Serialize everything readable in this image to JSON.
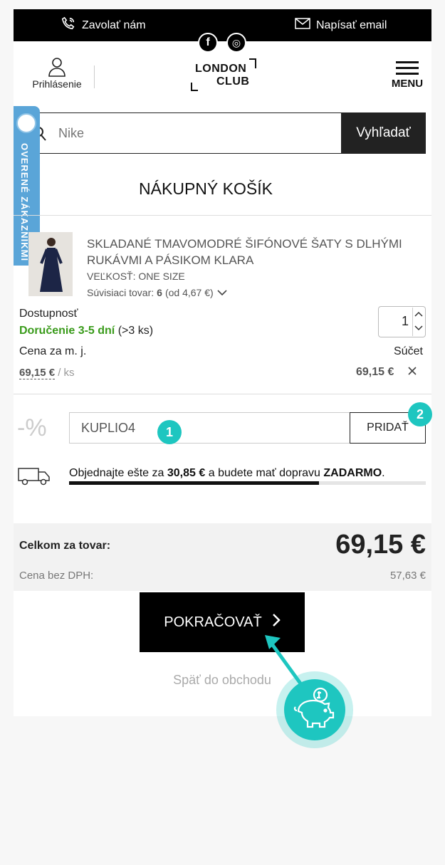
{
  "topbar": {
    "call_label": "Zavolať nám",
    "email_label": "Napísať email"
  },
  "social": {
    "facebook": "f",
    "instagram": "◎"
  },
  "header": {
    "login_label": "Prihlásenie",
    "logo_line1": "LONDON",
    "logo_line2": "CLUB",
    "menu_label": "MENU"
  },
  "search": {
    "placeholder": "Nike",
    "button_label": "Vyhľadať"
  },
  "side_tab": {
    "label": "OVERENÉ ZÁKAZNÍKMI"
  },
  "page_title": "NÁKUPNÝ KOŠÍK",
  "cart": {
    "item": {
      "name": "SKLADANÉ TMAVOMODRÉ ŠIFÓNOVÉ ŠATY S DLHÝMI RUKÁVMI A PÁSIKOM KLARA",
      "size": "VEĽKOSŤ: ONE SIZE",
      "related_prefix": "Súvisiaci tovar:",
      "related_count": "6",
      "related_from": "(od 4,67 €)",
      "availability_label": "Dostupnosť",
      "delivery": "Doručenie 3-5 dní",
      "stock": "(>3 ks)",
      "quantity": "1",
      "unit_price_label": "Cena za m. j.",
      "sum_label": "Súčet",
      "unit_price": "69,15 €",
      "unit_suffix": "/ ks",
      "total": "69,15 €"
    }
  },
  "coupon": {
    "percent_icon": "-%",
    "code": "KUPLIO4",
    "button_label": "PRIDAŤ"
  },
  "steps": {
    "one": "1",
    "two": "2"
  },
  "shipping": {
    "prefix": "Objednajte ešte za",
    "amount": "30,85 €",
    "middle": "a budete mať dopravu",
    "free": "ZADARMO",
    "suffix": ".",
    "progress": 0.7
  },
  "summary": {
    "total_label": "Celkom za tovar:",
    "total_value": "69,15 €",
    "net_label": "Cena bez DPH:",
    "net_value": "57,63 €"
  },
  "cta": {
    "continue_label": "POKRAČOVAŤ",
    "back_label": "Späť do obchodu"
  },
  "colors": {
    "accent": "#1ec6c0",
    "green": "#3a9b1b",
    "blue_tab": "#5aa5d8",
    "black": "#000000"
  }
}
